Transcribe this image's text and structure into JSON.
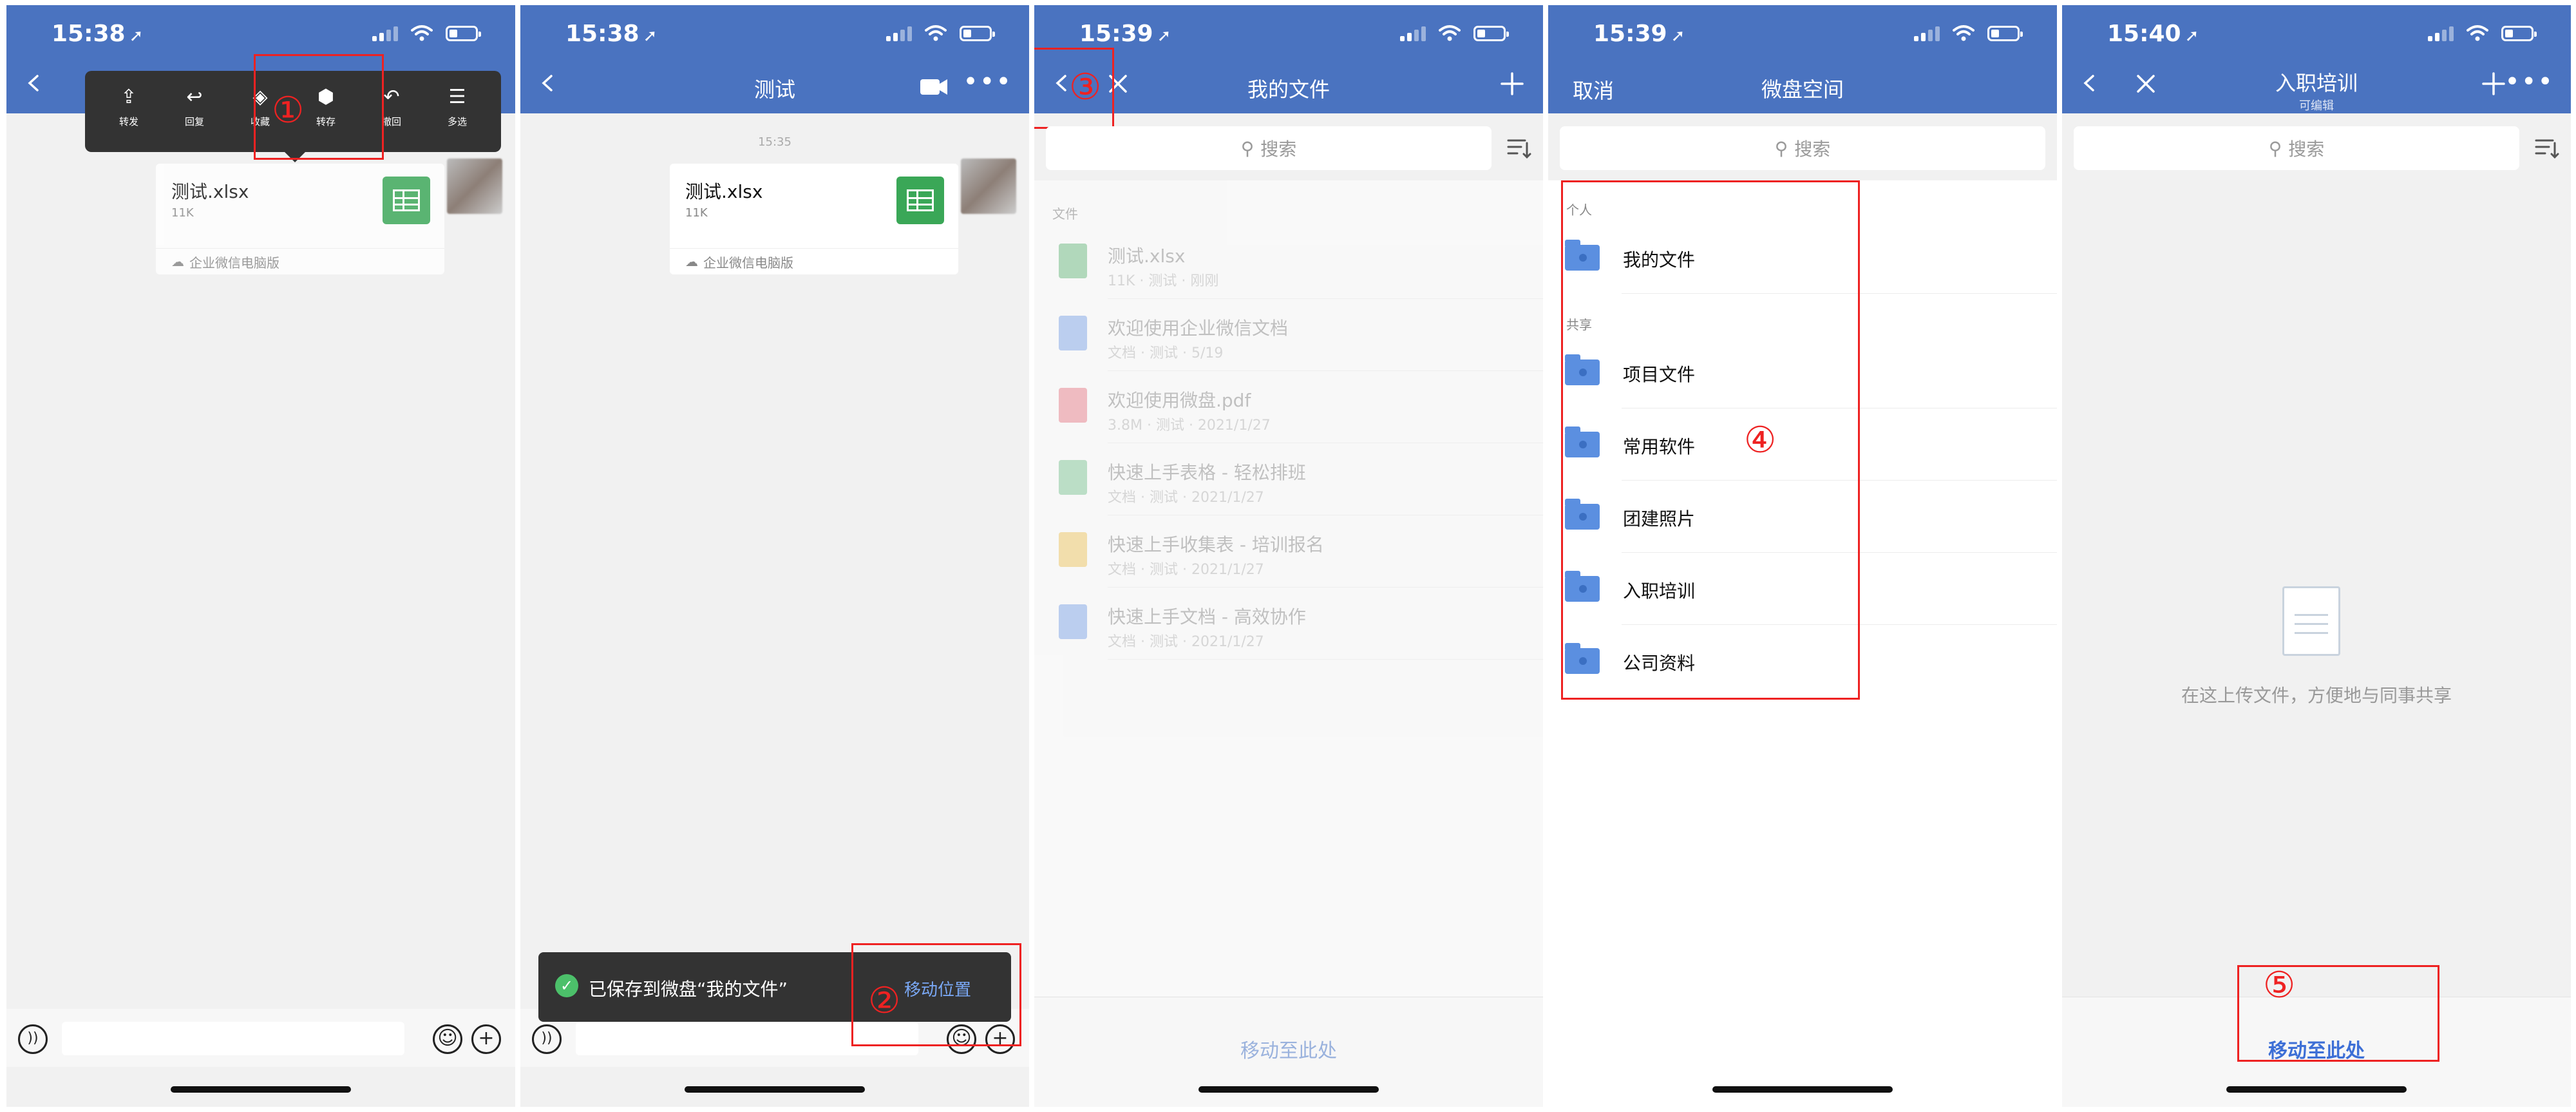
{
  "phones": [
    {
      "status": {
        "time": "15:38"
      },
      "menu": {
        "items": [
          "转发",
          "回复",
          "收藏",
          "转存",
          "撤回",
          "多选"
        ]
      },
      "bubble": {
        "file_name": "测试.xlsx",
        "file_size": "11K",
        "source": "企业微信电脑版"
      },
      "annotation": "①"
    },
    {
      "status": {
        "time": "15:38"
      },
      "title": "测试",
      "timestamp": "15:35",
      "bubble": {
        "file_name": "测试.xlsx",
        "file_size": "11K",
        "source": "企业微信电脑版"
      },
      "toast": {
        "text": "已保存到微盘“我的文件”",
        "action": "移动位置"
      },
      "annotation": "②"
    },
    {
      "status": {
        "time": "15:39"
      },
      "title": "我的文件",
      "search_placeholder": "搜索",
      "section": "文件",
      "files": [
        {
          "name": "测试.xlsx",
          "meta": "11K · 测试 · 刚刚",
          "color": "#7dc58f"
        },
        {
          "name": "欢迎使用企业微信文档",
          "meta": "文档 · 测试 · 5/19",
          "color": "#8fb3ef"
        },
        {
          "name": "欢迎使用微盘.pdf",
          "meta": "3.8M · 测试 · 2021/1/27",
          "color": "#ef8f9a"
        },
        {
          "name": "快速上手表格 - 轻松排班",
          "meta": "文档 · 测试 · 2021/1/27",
          "color": "#8fd0a3"
        },
        {
          "name": "快速上手收集表 - 培训报名",
          "meta": "文档 · 测试 · 2021/1/27",
          "color": "#f3cf74"
        },
        {
          "name": "快速上手文档 - 高效协作",
          "meta": "文档 · 测试 · 2021/1/27",
          "color": "#8fb3ef"
        }
      ],
      "bottom_action": "移动至此处",
      "annotation": "③"
    },
    {
      "status": {
        "time": "15:39"
      },
      "cancel": "取消",
      "title": "微盘空间",
      "search_placeholder": "搜索",
      "section_personal": "个人",
      "personal": [
        "我的文件"
      ],
      "section_shared": "共享",
      "shared": [
        "项目文件",
        "常用软件",
        "团建照片",
        "入职培训",
        "公司资料"
      ],
      "annotation": "④"
    },
    {
      "status": {
        "time": "15:40"
      },
      "title": "入职培训",
      "subtitle": "可编辑",
      "search_placeholder": "搜索",
      "empty_text": "在这上传文件，方便地与同事共享",
      "bottom_action": "移动至此处",
      "annotation": "⑤"
    }
  ],
  "colors": {
    "header": "#4a73c0",
    "annotation": "#e22222",
    "link": "#4a7be0"
  }
}
